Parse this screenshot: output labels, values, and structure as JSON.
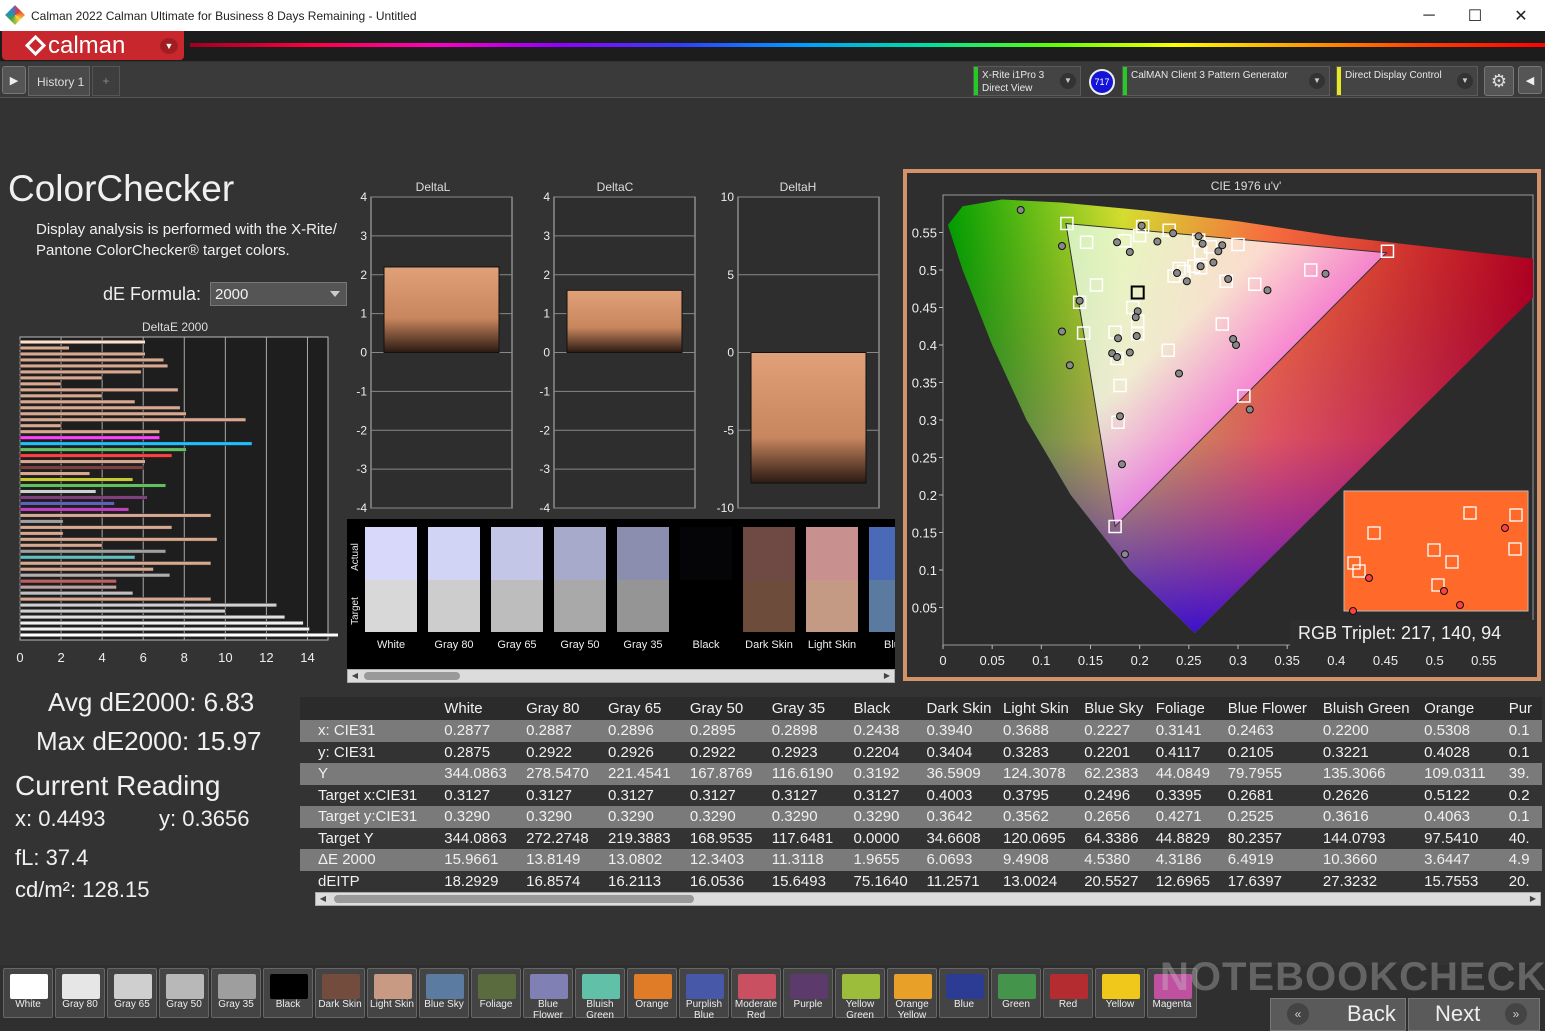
{
  "window": {
    "title": "Calman 2022 Calman Ultimate for Business 8 Days Remaining  - Untitled",
    "minimize": "─",
    "maximize": "☐",
    "close": "✕"
  },
  "app": {
    "logo_text": "calman"
  },
  "tabs": {
    "history_label": "History 1",
    "add_label": "+"
  },
  "devices": {
    "meter_line1": "X-Rite i1Pro 3",
    "meter_line2": "Direct View",
    "badge": "717",
    "pattern_generator": "CalMAN Client 3 Pattern Generator",
    "display_control": "Direct Display Control"
  },
  "page": {
    "title": "ColorChecker",
    "description": "Display analysis is performed with the X-Rite/ Pantone ColorChecker® target colors.",
    "formula_label": "dE Formula:",
    "formula_value": "2000"
  },
  "stats": {
    "avg": "Avg dE2000: 6.83",
    "max": "Max dE2000: 15.97",
    "current_title": "Current Reading",
    "x": "x: 0.4493",
    "y": "y: 0.3656",
    "fl": "fL: 37.4",
    "cdm2": "cd/m²: 128.15"
  },
  "rgb_triplet": "RGB Triplet: 217, 140, 94",
  "accent_color": "#d4926a",
  "chart_data": [
    {
      "type": "bar",
      "title": "DeltaE 2000",
      "orientation": "horizontal",
      "xlim": [
        0,
        15
      ],
      "xticks": [
        "0",
        "2",
        "4",
        "6",
        "8",
        "10",
        "12",
        "14"
      ],
      "values": [
        6.1,
        2.4,
        6.1,
        7.0,
        7.2,
        5.9,
        4.0,
        2.0,
        7.7,
        4.0,
        5.6,
        7.8,
        8.1,
        11.0,
        2.0,
        6.8,
        6.8,
        11.3,
        8.1,
        7.4,
        6.1,
        6.0,
        3.4,
        5.5,
        7.1,
        3.7,
        6.2,
        4.6,
        5.3,
        9.3,
        2.1,
        7.4,
        2.1,
        9.6,
        4.0,
        7.1,
        5.6,
        9.3,
        6.5,
        7.3,
        4.7,
        4.7,
        5.5,
        9.3,
        12.5,
        10.0,
        12.9,
        13.8,
        14.1,
        15.97
      ],
      "colors": [
        "#ffe0cc",
        "#d9a890",
        "#d9a890",
        "#d9a890",
        "#d9a890",
        "#d9a890",
        "#d9a890",
        "#d9a890",
        "#d9a890",
        "#d9a890",
        "#d9a890",
        "#d9a890",
        "#d9a890",
        "#d9a890",
        "#d9a890",
        "#d9a890",
        "#ff40ff",
        "#20c0ff",
        "#66c066",
        "#ff4040",
        "#d9a890",
        "#804040",
        "#d9a890",
        "#c8c830",
        "#60c060",
        "#d0d0d0",
        "#804080",
        "#6060c0",
        "#c040c0",
        "#d9a890",
        "#a0a0a0",
        "#d9a890",
        "#d9a890",
        "#d9a890",
        "#d9a890",
        "#a0a0a0",
        "#60c0c0",
        "#d9a890",
        "#d9a890",
        "#b0b0b0",
        "#c06060",
        "#c0a0a0",
        "#c0c0c0",
        "#d9a890",
        "#d0d0d0",
        "#d0d0d0",
        "#e0e0e0",
        "#f0f0f0",
        "#f0f0f0",
        "#ffffff"
      ]
    },
    {
      "type": "bar",
      "title": "DeltaL",
      "ylim": [
        -4,
        4
      ],
      "yticks": [
        "4",
        "3",
        "2",
        "1",
        "0",
        "-1",
        "-2",
        "-3",
        "-4"
      ],
      "values": [
        2.2
      ]
    },
    {
      "type": "bar",
      "title": "DeltaC",
      "ylim": [
        -4,
        4
      ],
      "yticks": [
        "4",
        "3",
        "2",
        "1",
        "0",
        "-1",
        "-2",
        "-3",
        "-4"
      ],
      "values": [
        1.6
      ]
    },
    {
      "type": "bar",
      "title": "DeltaH",
      "ylim": [
        -10,
        10
      ],
      "yticks": [
        "10",
        "5",
        "0",
        "-5",
        "-10"
      ],
      "values": [
        -8.4
      ]
    },
    {
      "type": "scatter",
      "title": "CIE 1976 u'v'",
      "xlim": [
        0,
        0.6
      ],
      "ylim": [
        0,
        0.6
      ],
      "xticks": [
        "0",
        "0.05",
        "0.1",
        "0.15",
        "0.2",
        "0.25",
        "0.3",
        "0.35",
        "0.4",
        "0.45",
        "0.5",
        "0.55"
      ],
      "yticks": [
        "0.55",
        "0.5",
        "0.45",
        "0.4",
        "0.35",
        "0.3",
        "0.25",
        "0.2",
        "0.15",
        "0.1",
        "0.05"
      ],
      "targets": [
        [
          0.126,
          0.562
        ],
        [
          0.146,
          0.537
        ],
        [
          0.156,
          0.48
        ],
        [
          0.139,
          0.457
        ],
        [
          0.143,
          0.416
        ],
        [
          0.175,
          0.417
        ],
        [
          0.177,
          0.382
        ],
        [
          0.18,
          0.346
        ],
        [
          0.178,
          0.297
        ],
        [
          0.175,
          0.158
        ],
        [
          0.185,
          0.539
        ],
        [
          0.203,
          0.558
        ],
        [
          0.23,
          0.553
        ],
        [
          0.2,
          0.546
        ],
        [
          0.193,
          0.45
        ],
        [
          0.198,
          0.415
        ],
        [
          0.198,
          0.432
        ],
        [
          0.229,
          0.393
        ],
        [
          0.235,
          0.492
        ],
        [
          0.24,
          0.502
        ],
        [
          0.245,
          0.498
        ],
        [
          0.255,
          0.505
        ],
        [
          0.262,
          0.503
        ],
        [
          0.26,
          0.54
        ],
        [
          0.262,
          0.523
        ],
        [
          0.272,
          0.531
        ],
        [
          0.3,
          0.534
        ],
        [
          0.288,
          0.485
        ],
        [
          0.317,
          0.481
        ],
        [
          0.284,
          0.428
        ],
        [
          0.306,
          0.332
        ],
        [
          0.374,
          0.5
        ],
        [
          0.452,
          0.525
        ]
      ],
      "measurements": [
        [
          0.079,
          0.58
        ],
        [
          0.121,
          0.532
        ],
        [
          0.139,
          0.459
        ],
        [
          0.121,
          0.418
        ],
        [
          0.129,
          0.373
        ],
        [
          0.177,
          0.537
        ],
        [
          0.19,
          0.524
        ],
        [
          0.202,
          0.559
        ],
        [
          0.218,
          0.538
        ],
        [
          0.234,
          0.549
        ],
        [
          0.26,
          0.545
        ],
        [
          0.264,
          0.535
        ],
        [
          0.28,
          0.525
        ],
        [
          0.284,
          0.533
        ],
        [
          0.238,
          0.496
        ],
        [
          0.248,
          0.485
        ],
        [
          0.262,
          0.505
        ],
        [
          0.275,
          0.51
        ],
        [
          0.29,
          0.488
        ],
        [
          0.33,
          0.473
        ],
        [
          0.389,
          0.495
        ],
        [
          0.198,
          0.445
        ],
        [
          0.196,
          0.437
        ],
        [
          0.197,
          0.412
        ],
        [
          0.178,
          0.409
        ],
        [
          0.172,
          0.389
        ],
        [
          0.177,
          0.384
        ],
        [
          0.19,
          0.39
        ],
        [
          0.24,
          0.362
        ],
        [
          0.298,
          0.4
        ],
        [
          0.295,
          0.408
        ],
        [
          0.312,
          0.314
        ],
        [
          0.18,
          0.305
        ],
        [
          0.182,
          0.241
        ],
        [
          0.185,
          0.121
        ]
      ],
      "current_point": [
        0.198,
        0.47
      ]
    }
  ],
  "swatches": {
    "labels": [
      "White",
      "Gray 80",
      "Gray 65",
      "Gray 50",
      "Gray 35",
      "Black",
      "Dark Skin",
      "Light Skin",
      "Blue"
    ],
    "actual_colors": [
      "#d8d8fa",
      "#d2d4f6",
      "#c4c6e8",
      "#a8aacc",
      "#8c8eb0",
      "#050508",
      "#6f4a45",
      "#c8908e",
      "#4a6ab8"
    ],
    "target_colors": [
      "#d8d8d8",
      "#cdcdcd",
      "#bdbdbd",
      "#a9a9a9",
      "#959595",
      "#000000",
      "#6e4c3c",
      "#c49a84",
      "#5a7aa0"
    ],
    "actual_label": "Actual",
    "target_label": "Target"
  },
  "table": {
    "columns": [
      "White",
      "Gray 80",
      "Gray 65",
      "Gray 50",
      "Gray 35",
      "Black",
      "Dark Skin",
      "Light Skin",
      "Blue Sky",
      "Foliage",
      "Blue Flower",
      "Bluish Green",
      "Orange",
      "Pur"
    ],
    "rows": [
      {
        "label": "x: CIE31",
        "values": [
          "0.2877",
          "0.2887",
          "0.2896",
          "0.2895",
          "0.2898",
          "0.2438",
          "0.3940",
          "0.3688",
          "0.2227",
          "0.3141",
          "0.2463",
          "0.2200",
          "0.5308",
          "0.1"
        ]
      },
      {
        "label": "y: CIE31",
        "values": [
          "0.2875",
          "0.2922",
          "0.2926",
          "0.2922",
          "0.2923",
          "0.2204",
          "0.3404",
          "0.3283",
          "0.2201",
          "0.4117",
          "0.2105",
          "0.3221",
          "0.4028",
          "0.1"
        ]
      },
      {
        "label": "Y",
        "values": [
          "344.0863",
          "278.5470",
          "221.4541",
          "167.8769",
          "116.6190",
          "0.3192",
          "36.5909",
          "124.3078",
          "62.2383",
          "44.0849",
          "79.7955",
          "135.3066",
          "109.0311",
          "39."
        ]
      },
      {
        "label": "Target x:CIE31",
        "values": [
          "0.3127",
          "0.3127",
          "0.3127",
          "0.3127",
          "0.3127",
          "0.3127",
          "0.4003",
          "0.3795",
          "0.2496",
          "0.3395",
          "0.2681",
          "0.2626",
          "0.5122",
          "0.2"
        ]
      },
      {
        "label": "Target y:CIE31",
        "values": [
          "0.3290",
          "0.3290",
          "0.3290",
          "0.3290",
          "0.3290",
          "0.3290",
          "0.3642",
          "0.3562",
          "0.2656",
          "0.4271",
          "0.2525",
          "0.3616",
          "0.4063",
          "0.1"
        ]
      },
      {
        "label": "Target Y",
        "values": [
          "344.0863",
          "272.2748",
          "219.3883",
          "168.9535",
          "117.6481",
          "0.0000",
          "34.6608",
          "120.0695",
          "64.3386",
          "44.8829",
          "80.2357",
          "144.0793",
          "97.5410",
          "40."
        ]
      },
      {
        "label": "ΔE 2000",
        "values": [
          "15.9661",
          "13.8149",
          "13.0802",
          "12.3403",
          "11.3118",
          "1.9655",
          "6.0693",
          "9.4908",
          "4.5380",
          "4.3186",
          "6.4919",
          "10.3660",
          "3.6447",
          "4.9"
        ]
      },
      {
        "label": "dEITP",
        "values": [
          "18.2929",
          "16.8574",
          "16.2113",
          "16.0536",
          "15.6493",
          "75.1640",
          "11.2571",
          "13.0024",
          "20.5527",
          "12.6965",
          "17.6397",
          "27.3232",
          "15.7553",
          "20."
        ]
      }
    ]
  },
  "bottom_swatches": [
    {
      "label": "White",
      "color": "#ffffff"
    },
    {
      "label": "Gray 80",
      "color": "#e6e6e6"
    },
    {
      "label": "Gray 65",
      "color": "#cfcfcf"
    },
    {
      "label": "Gray 50",
      "color": "#b8b8b8"
    },
    {
      "label": "Gray 35",
      "color": "#9e9e9e"
    },
    {
      "label": "Black",
      "color": "#000000"
    },
    {
      "label": "Dark Skin",
      "color": "#734c3e"
    },
    {
      "label": "Light Skin",
      "color": "#c89a84"
    },
    {
      "label": "Blue Sky",
      "color": "#5c7ba0"
    },
    {
      "label": "Foliage",
      "color": "#5a6b3e"
    },
    {
      "label": "Blue Flower",
      "color": "#8080b4"
    },
    {
      "label": "Bluish Green",
      "color": "#60c0a8"
    },
    {
      "label": "Orange",
      "color": "#e07c28"
    },
    {
      "label": "Purplish Blue",
      "color": "#4858a8"
    },
    {
      "label": "Moderate Red",
      "color": "#c85060"
    },
    {
      "label": "Purple",
      "color": "#5c3a6c"
    },
    {
      "label": "Yellow Green",
      "color": "#9cbc3c"
    },
    {
      "label": "Orange Yellow",
      "color": "#e8a028"
    },
    {
      "label": "Blue",
      "color": "#2c3c94"
    },
    {
      "label": "Green",
      "color": "#44944c"
    },
    {
      "label": "Red",
      "color": "#b42c30"
    },
    {
      "label": "Yellow",
      "color": "#f0c81c"
    },
    {
      "label": "Magenta",
      "color": "#c050a0"
    }
  ],
  "nav": {
    "back": "Back",
    "next": "Next"
  },
  "watermark": "NOTEBOOKCHECK"
}
